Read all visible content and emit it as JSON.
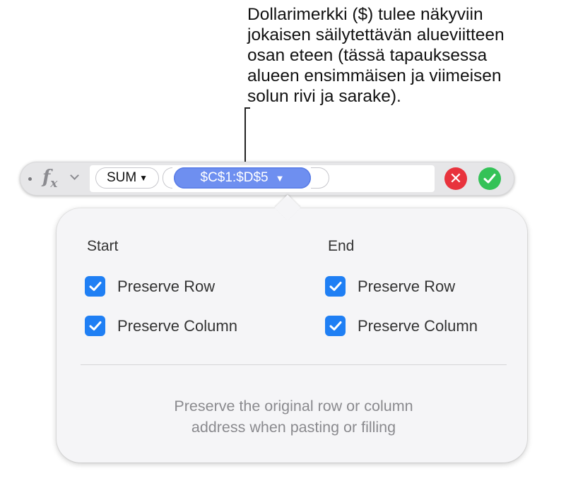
{
  "callout": {
    "lines": [
      "Dollarimerkki ($) tulee näkyviin",
      "jokaisen säilytettävän alueviitteen",
      "osan eteen (tässä tapauksessa",
      "alueen ensimmäisen ja viimeisen",
      "solun rivi ja sarake)."
    ]
  },
  "formula_bar": {
    "fx_label": "f",
    "fx_sub": "x",
    "function_token": "SUM",
    "function_caret": "▼",
    "range_token": "$C$1:$D$5",
    "range_caret": "▼",
    "cancel_glyph": "✕",
    "colors": {
      "range_token": "#6e8ff0",
      "cancel": "#e8333d",
      "accept": "#34c257"
    }
  },
  "popover": {
    "start_heading": "Start",
    "end_heading": "End",
    "start_options": [
      {
        "label": "Preserve Row",
        "checked": true
      },
      {
        "label": "Preserve Column",
        "checked": true
      }
    ],
    "end_options": [
      {
        "label": "Preserve Row",
        "checked": true
      },
      {
        "label": "Preserve Column",
        "checked": true
      }
    ],
    "help_lines": [
      "Preserve the original row or column",
      "address when pasting or filling"
    ],
    "colors": {
      "checkbox": "#1f7ff4"
    }
  }
}
